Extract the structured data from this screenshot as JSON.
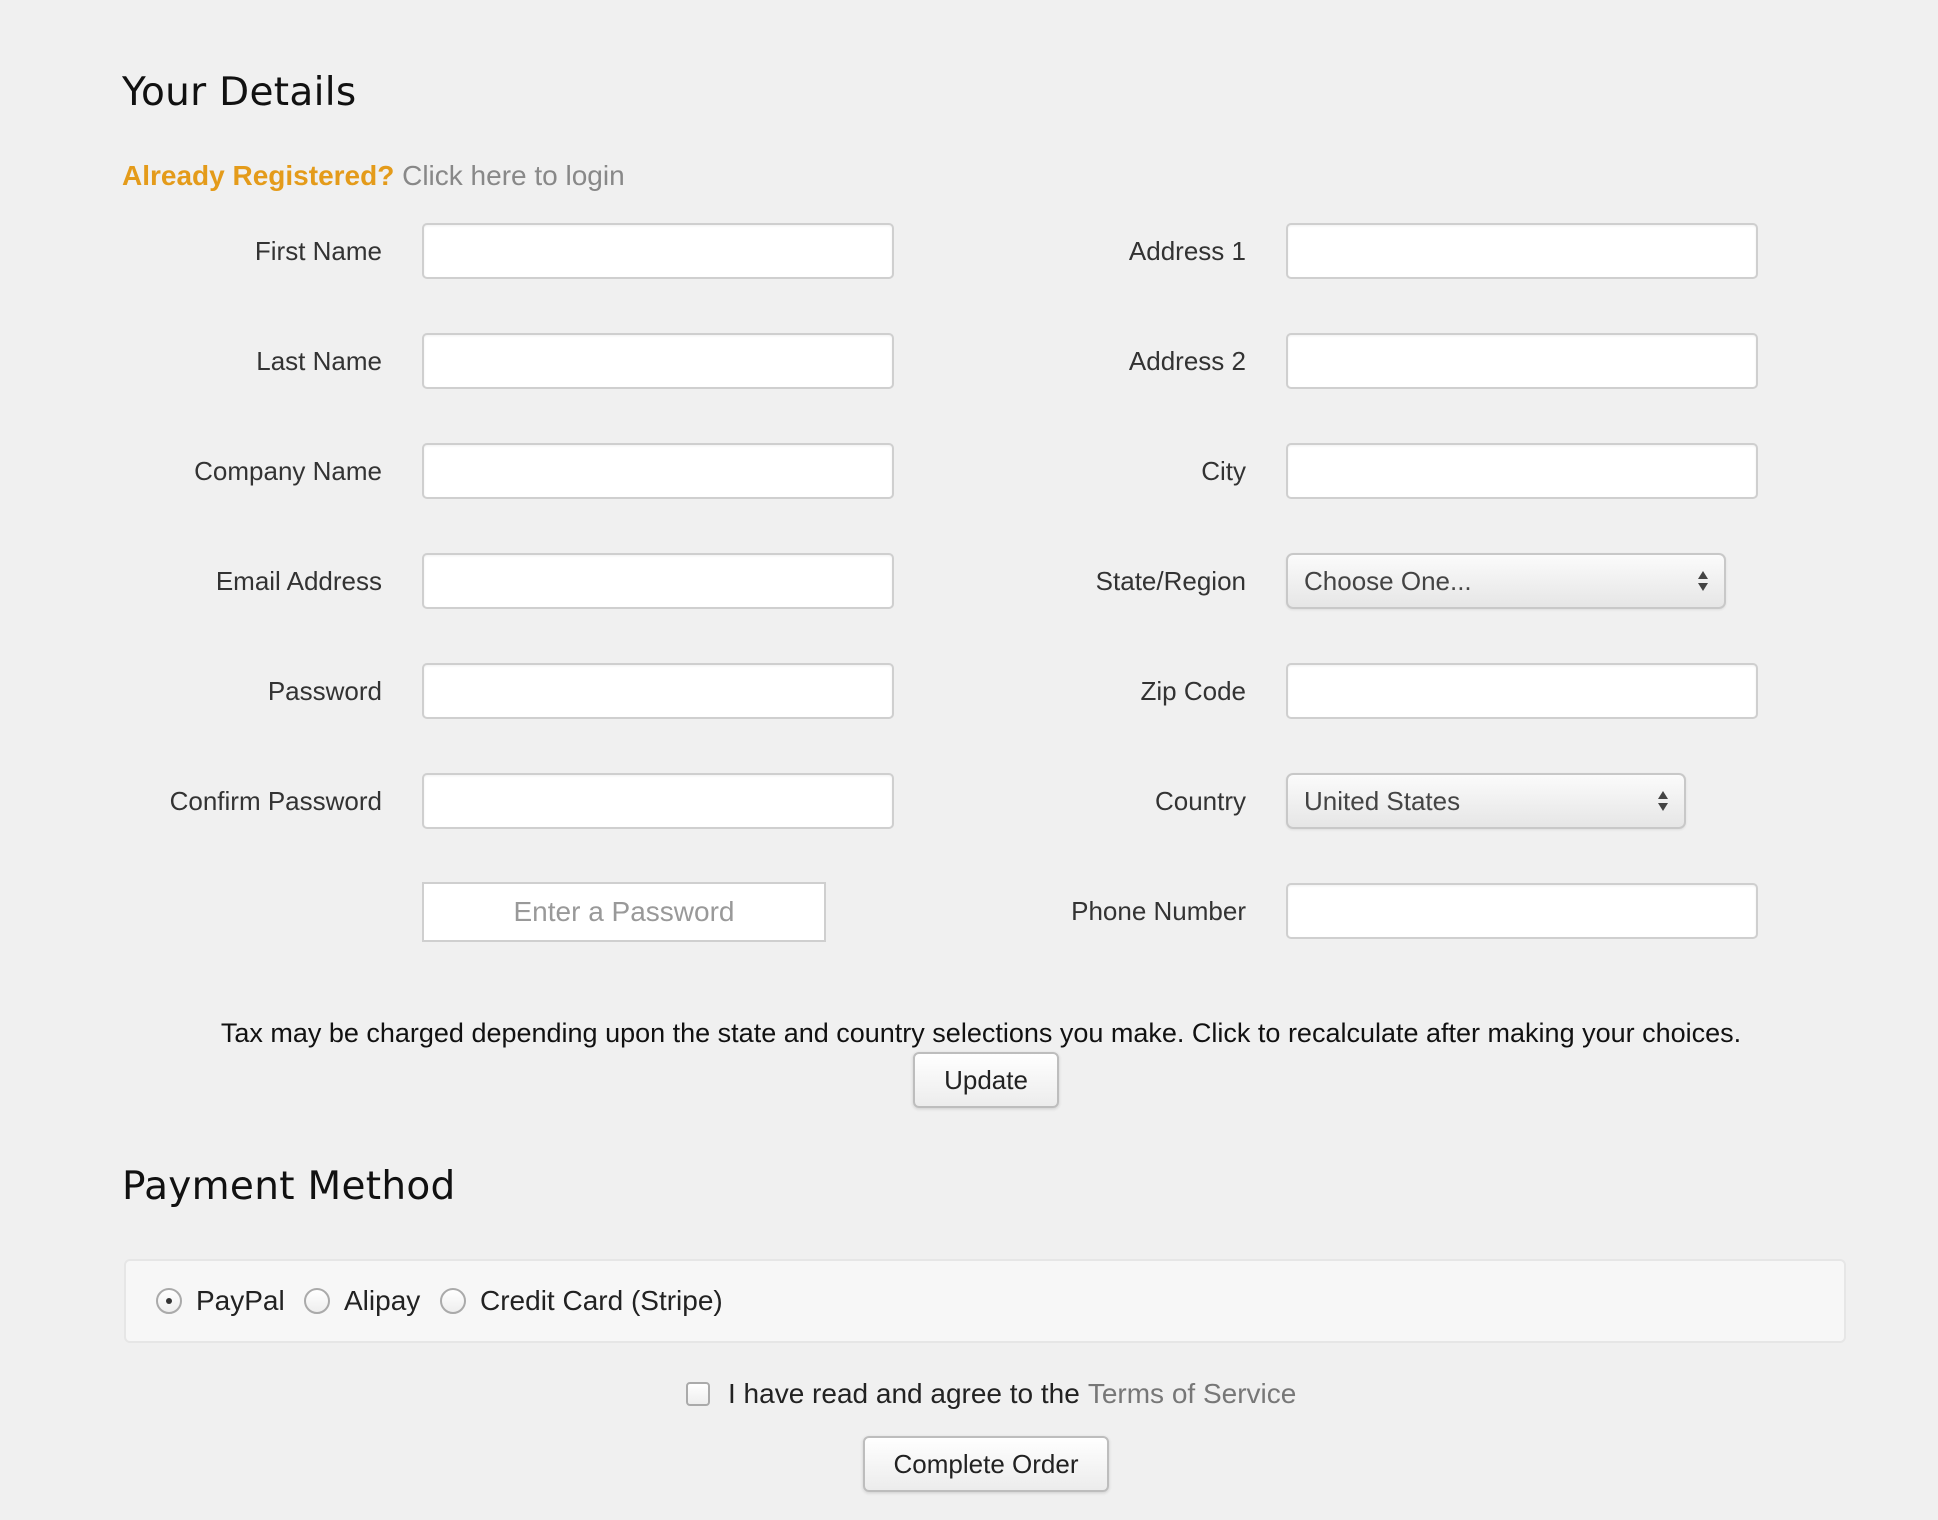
{
  "details": {
    "title": "Your Details",
    "already_registered": "Already Registered?",
    "login_link": "Click here to login",
    "left_fields": [
      {
        "label": "First Name",
        "value": ""
      },
      {
        "label": "Last Name",
        "value": ""
      },
      {
        "label": "Company Name",
        "value": ""
      },
      {
        "label": "Email Address",
        "value": ""
      },
      {
        "label": "Password",
        "value": ""
      },
      {
        "label": "Confirm Password",
        "value": ""
      }
    ],
    "password_button": "Enter a Password",
    "right_fields": {
      "address1": {
        "label": "Address 1",
        "value": ""
      },
      "address2": {
        "label": "Address 2",
        "value": ""
      },
      "city": {
        "label": "City",
        "value": ""
      },
      "state": {
        "label": "State/Region",
        "selected": "Choose One..."
      },
      "zip": {
        "label": "Zip Code",
        "value": ""
      },
      "country": {
        "label": "Country",
        "selected": "United States"
      },
      "phone": {
        "label": "Phone Number",
        "value": ""
      }
    },
    "tax_note": "Tax may be charged depending upon the state and country selections you make. Click to recalculate after making your choices.",
    "update_label": "Update"
  },
  "payment": {
    "title": "Payment Method",
    "options": [
      {
        "label": "PayPal",
        "checked": true
      },
      {
        "label": "Alipay",
        "checked": false
      },
      {
        "label": "Credit Card (Stripe)",
        "checked": false
      }
    ],
    "terms_text": "I have read and agree to the",
    "terms_link": "Terms of Service",
    "complete_label": "Complete Order"
  },
  "colors": {
    "background": "#f0f0f0",
    "accent_orange": "#e49b1a",
    "link_gray": "#888888"
  }
}
